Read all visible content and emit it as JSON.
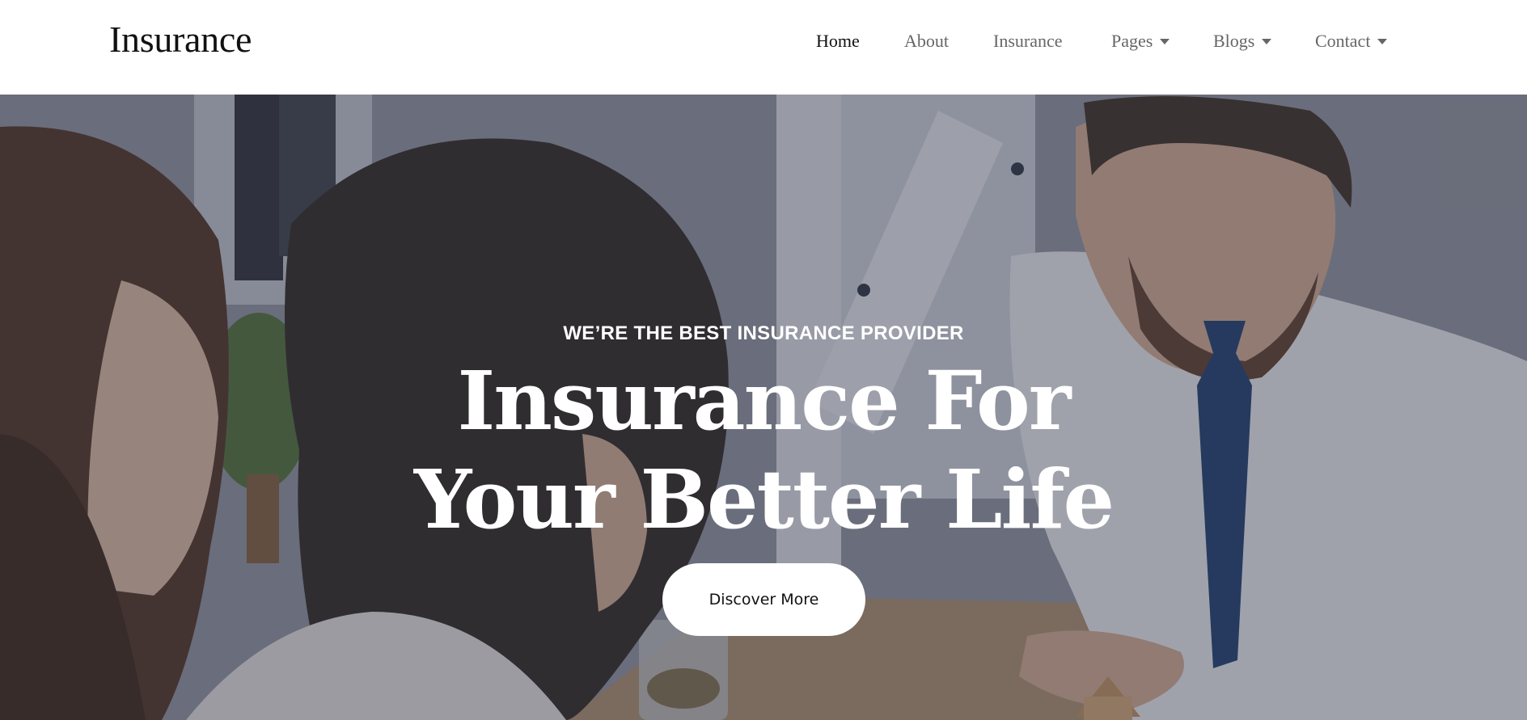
{
  "brand": {
    "name": "Insurance"
  },
  "nav": {
    "items": [
      {
        "label": "Home",
        "active": true,
        "dropdown": false
      },
      {
        "label": "About",
        "active": false,
        "dropdown": false
      },
      {
        "label": "Insurance",
        "active": false,
        "dropdown": false
      },
      {
        "label": "Pages",
        "active": false,
        "dropdown": true
      },
      {
        "label": "Blogs",
        "active": false,
        "dropdown": true
      },
      {
        "label": "Contact",
        "active": false,
        "dropdown": true
      }
    ]
  },
  "hero": {
    "eyebrow": "WE’RE THE BEST INSURANCE PROVIDER",
    "title_line1": "Insurance For",
    "title_line2": "Your Better Life",
    "cta_label": "Discover More",
    "image": "photo of a couple meeting with an insurance agent at a desk"
  },
  "colors": {
    "header_bg": "#ffffff",
    "nav_text": "#666666",
    "nav_active": "#111111",
    "hero_text": "#ffffff",
    "cta_bg": "#ffffff",
    "cta_text": "#111111"
  }
}
